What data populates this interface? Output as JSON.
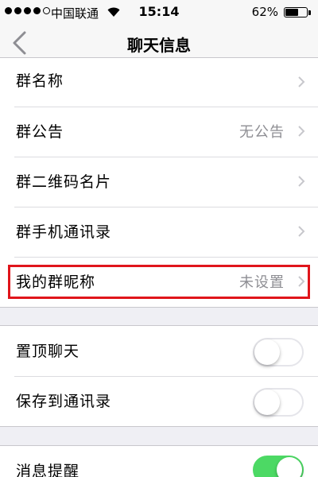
{
  "status_bar": {
    "carrier": "中国联通",
    "time": "15:14",
    "battery_percent": "62%",
    "battery_level": 0.62,
    "signal_bars_filled": 4,
    "signal_bars_total": 5
  },
  "nav": {
    "title": "聊天信息"
  },
  "group_info": [
    {
      "label": "群名称",
      "value": ""
    },
    {
      "label": "群公告",
      "value": "无公告"
    },
    {
      "label": "群二维码名片",
      "value": ""
    },
    {
      "label": "群手机通讯录",
      "value": ""
    },
    {
      "label": "我的群昵称",
      "value": "未设置"
    }
  ],
  "chat_settings": [
    {
      "label": "置顶聊天",
      "on": false
    },
    {
      "label": "保存到通讯录",
      "on": false
    }
  ],
  "notification": [
    {
      "label": "消息提醒",
      "on": true
    }
  ],
  "colors": {
    "highlight": "#e0151b",
    "switch_on": "#4cd964",
    "secondary_text": "#8e8e93"
  }
}
